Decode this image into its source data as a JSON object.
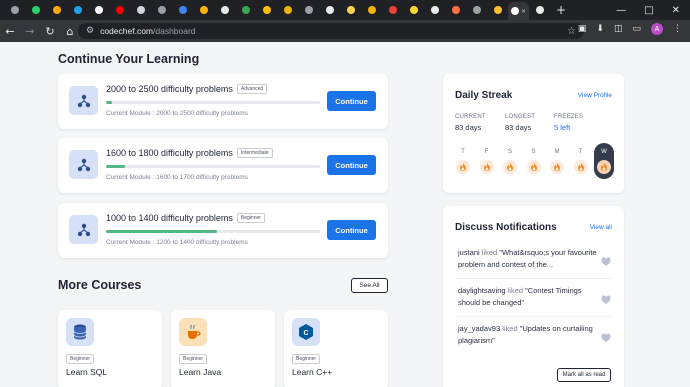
{
  "browser": {
    "url_host": "codechef.com",
    "url_path": "/dashboard",
    "profile_initial": "A",
    "tab_count": 26
  },
  "learning": {
    "title": "Continue Your Learning",
    "items": [
      {
        "title": "2000 to 2500 difficulty problems",
        "badge": "Advanced",
        "progress": 0.03,
        "module": "Current Module : 2000 to 2500 difficulty problems",
        "button": "Continue"
      },
      {
        "title": "1600 to 1800 difficulty problems",
        "badge": "Intermediate",
        "progress": 0.09,
        "module": "Current Module : 1600 to 1700 difficulty problems",
        "button": "Continue"
      },
      {
        "title": "1000 to 1400 difficulty problems",
        "badge": "Beginner",
        "progress": 0.52,
        "module": "Current Module : 1200 to 1400 difficulty problems",
        "button": "Continue"
      }
    ]
  },
  "courses": {
    "title": "More Courses",
    "see_all": "See All",
    "items": [
      {
        "name": "Learn SQL",
        "badge": "Beginner",
        "icon": "database-icon"
      },
      {
        "name": "Learn Java",
        "badge": "Beginner",
        "icon": "java-cup-icon"
      },
      {
        "name": "Learn C++",
        "badge": "Beginner",
        "icon": "cpp-icon"
      }
    ]
  },
  "streak": {
    "title": "Daily Streak",
    "view_profile": "View Profile",
    "current_label": "CURRENT",
    "current_value": "83 days",
    "longest_label": "LONGEST",
    "longest_value": "83 days",
    "freezes_label": "FREEZES",
    "freezes_value": "5 left",
    "days": [
      "T",
      "F",
      "S",
      "S",
      "M",
      "T",
      "W"
    ],
    "today_index": 6
  },
  "discuss": {
    "title": "Discuss Notifications",
    "view_all": "View all",
    "items": [
      {
        "user": "justani",
        "action": " liked ",
        "text": "\"What&rsquo;s your favourite problem and contest of the..."
      },
      {
        "user": "daylightsaving",
        "action": " liked ",
        "text": "\"Contest Timings should be changed\""
      },
      {
        "user": "jay_yadav93",
        "action": " liked ",
        "text": "\"Updates on curtailing plagiarism\""
      }
    ],
    "mark_all": "Mark all as read"
  },
  "colors": {
    "accent_blue": "#1a73e8",
    "progress_green": "#55b788",
    "flame_orange": "#f28c28"
  }
}
